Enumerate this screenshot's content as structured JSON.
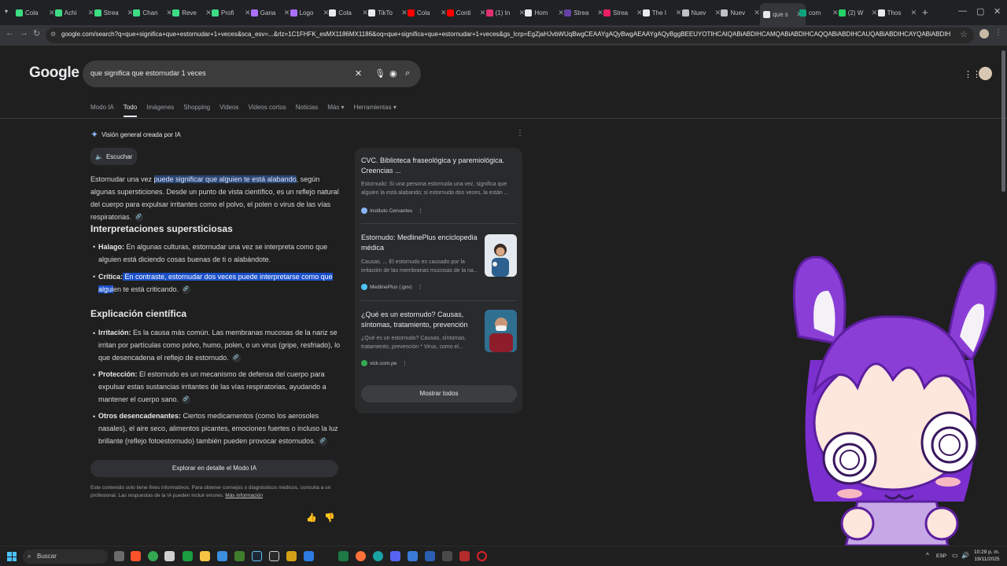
{
  "browser": {
    "tabs": [
      {
        "label": "Cola",
        "color": "#3ddc84"
      },
      {
        "label": "Achi",
        "color": "#3ddc84"
      },
      {
        "label": "Strea",
        "color": "#3ddc84"
      },
      {
        "label": "Chan",
        "color": "#3ddc84"
      },
      {
        "label": "Reve",
        "color": "#3ddc84"
      },
      {
        "label": "Profi",
        "color": "#3ddc84"
      },
      {
        "label": "Gana",
        "color": "#a970ff"
      },
      {
        "label": "Logo",
        "color": "#a970ff"
      },
      {
        "label": "Cola",
        "color": "#e8eaed"
      },
      {
        "label": "TikTo",
        "color": "#e8eaed"
      },
      {
        "label": "Cola",
        "color": "#ff0000"
      },
      {
        "label": "Conti",
        "color": "#ff0000"
      },
      {
        "label": "(1) In",
        "color": "#e1306c"
      },
      {
        "label": "Hom",
        "color": "#e8eaed"
      },
      {
        "label": "Strea",
        "color": "#6441a5"
      },
      {
        "label": "Strea",
        "color": "#e91e63"
      },
      {
        "label": "The I",
        "color": "#e8eaed"
      },
      {
        "label": "Nuev",
        "color": "#bdc1c6"
      },
      {
        "label": "Nuev",
        "color": "#bdc1c6"
      },
      {
        "label": "que s",
        "color": "#e8eaed"
      },
      {
        "label": "com",
        "color": "#10a37f"
      },
      {
        "label": "(2) W",
        "color": "#25d366"
      },
      {
        "label": "Thos",
        "color": "#e8eaed"
      }
    ],
    "active_tab_index": 19,
    "url": "google.com/search?q=que+significa+que+estornudar+1+veces&sca_esv=...&rlz=1C1FHFK_esMX1186MX1186&oq=que+significa+que+estornudar+1+veces&gs_lcrp=EgZjaHJvbWUqBwgCEAAYgAQyBwgAEAAYgAQyBggBEEUYOTIHCAIQABiABDIHCAMQABiABDIHCAQQABiABDIHCAUQABiABDIHCAYQABiABDIHCAcQABiABNIBCjY5OTA4ajBqMTWoAgiwAgHxBQcFSnB5UnO5&sourceid=chrome&ie=UTF-8"
  },
  "search": {
    "logo": "Google",
    "query": "que significa que estornudar 1 veces",
    "tabs": [
      "Modo IA",
      "Todo",
      "Imágenes",
      "Shopping",
      "Videos",
      "Videos cortos",
      "Noticias",
      "Más ▾",
      "Herramientas ▾"
    ],
    "active_tab": "Todo"
  },
  "ai_overview": {
    "heading": "Visión general creada por IA",
    "listen_label": "Escuchar",
    "intro_pre": "Estornudar una vez ",
    "intro_highlight": "puede significar que alguien te está alabando",
    "intro_post": ", según algunas supersticiones. Desde un punto de vista científico, es un reflejo natural del cuerpo para expulsar irritantes como el polvo, el polen o virus de las vías respiratorias.",
    "section1_title": "Interpretaciones supersticiosas",
    "s1_items": [
      {
        "term": "Halago:",
        "text": " En algunas culturas, estornudar una vez se interpreta como que alguien está diciendo cosas buenas de ti o alabándote."
      },
      {
        "term": "Crítica:",
        "highlight": " En contraste, estornudar dos veces puede interpretarse como que algui",
        "text": "en te está criticando."
      }
    ],
    "section2_title": "Explicación científica",
    "s2_items": [
      {
        "term": "Irritación:",
        "text": " Es la causa más común. Las membranas mucosas de la nariz se irritan por partículas como polvo, humo, polen, o un virus (gripe, resfriado), lo que desencadena el reflejo de estornudo."
      },
      {
        "term": "Protección:",
        "text": " El estornudo es un mecanismo de defensa del cuerpo para expulsar estas sustancias irritantes de las vías respiratorias, ayudando a mantener el cuerpo sano."
      },
      {
        "term": "Otros desencadenantes:",
        "text": " Ciertos medicamentos (como los aerosoles nasales), el aire seco, alimentos picantes, emociones fuertes o incluso la luz brillante (reflejo fotoestornudo) también pueden provocar estornudos."
      }
    ],
    "explore_label": "Explorar en detalle el Modo IA",
    "disclaimer": "Este contenido solo tiene fines informativos. Para obtener consejos o diagnósticos médicos, consulta a un profesional. Las respuestas de la IA pueden incluir errores. ",
    "disclaimer_link": "Más información"
  },
  "sources": {
    "items": [
      {
        "title": "CVC. Biblioteca fraseológica y paremiológica. Creencias ...",
        "snippet": "Estornudo: Si una persona estornuda una vez, significa que alguien la está alabando; si estornuda dos veces, la están ...",
        "site": "Instituto Cervantes",
        "site_color": "#8ab4f8"
      },
      {
        "title": "Estornudo: MedlinePlus enciclopedia médica",
        "snippet": "Causas. ... El estornudo es causado por la irritación de las membranas mucosas de la na...",
        "site": "MedlinePlus (.gov)",
        "site_color": "#4fc3f7"
      },
      {
        "title": "¿Qué es un estornudo? Causas, síntomas, tratamiento, prevención",
        "snippet": "¿Qué es un estornudo? Causas, síntomas, tratamiento, prevención * Virus, como el...",
        "site": "vick.com.pe",
        "site_color": "#34a853"
      }
    ],
    "show_all_label": "Mostrar todos"
  },
  "taskbar": {
    "search_label": "Buscar",
    "lang": "ESP",
    "time": "10:29 p. m.",
    "date": "19/11/2025"
  }
}
